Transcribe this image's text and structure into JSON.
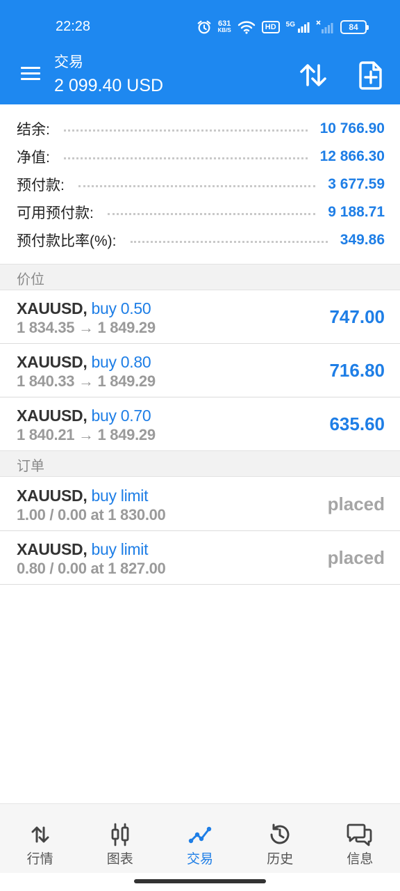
{
  "status_bar": {
    "time": "22:28",
    "net_speed_value": "631",
    "net_speed_unit": "KB/S",
    "hd_label": "HD",
    "network_label": "5G",
    "battery": "84"
  },
  "header": {
    "title": "交易",
    "balance": "2 099.40 USD",
    "icons": [
      "menu-icon",
      "sort-icon",
      "new-order-icon"
    ]
  },
  "summary": [
    {
      "label": "结余:",
      "value": "10 766.90"
    },
    {
      "label": "净值:",
      "value": "12 866.30"
    },
    {
      "label": "预付款:",
      "value": "3 677.59"
    },
    {
      "label": "可用预付款:",
      "value": "9 188.71"
    },
    {
      "label": "预付款比率(%):",
      "value": "349.86"
    }
  ],
  "positions_section": "价位",
  "positions": [
    {
      "symbol": "XAUUSD,",
      "side": "buy 0.50",
      "prices": "1 834.35 → 1 849.29",
      "profit": "747.00"
    },
    {
      "symbol": "XAUUSD,",
      "side": "buy 0.80",
      "prices": "1 840.33 → 1 849.29",
      "profit": "716.80"
    },
    {
      "symbol": "XAUUSD,",
      "side": "buy 0.70",
      "prices": "1 840.21 → 1 849.29",
      "profit": "635.60"
    }
  ],
  "orders_section": "订单",
  "orders": [
    {
      "symbol": "XAUUSD,",
      "side": "buy limit",
      "details": "1.00 / 0.00 at 1 830.00",
      "status": "placed"
    },
    {
      "symbol": "XAUUSD,",
      "side": "buy limit",
      "details": "0.80 / 0.00 at 1 827.00",
      "status": "placed"
    }
  ],
  "bottom_nav": [
    {
      "label": "行情",
      "icon": "quotes-icon",
      "active": false
    },
    {
      "label": "图表",
      "icon": "chart-icon",
      "active": false
    },
    {
      "label": "交易",
      "icon": "trade-icon",
      "active": true
    },
    {
      "label": "历史",
      "icon": "history-icon",
      "active": false
    },
    {
      "label": "信息",
      "icon": "messages-icon",
      "active": false
    }
  ],
  "colors": {
    "header_bg": "#1e88f0",
    "accent": "#1e7ee6",
    "muted": "#9a9a9a"
  }
}
